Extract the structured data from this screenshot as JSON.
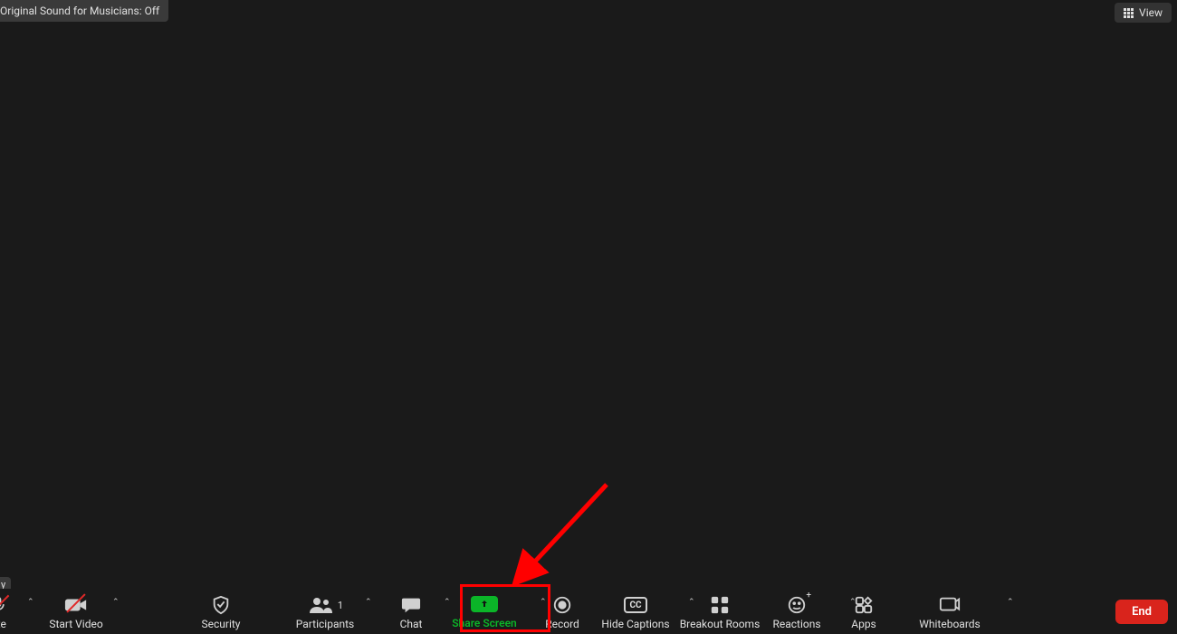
{
  "topbar": {
    "original_sound_label": "Original Sound for Musicians: Off",
    "view_label": "View"
  },
  "letter_pill": "y",
  "toolbar": {
    "mute_label": "ute",
    "start_video_label": "Start Video",
    "security_label": "Security",
    "participants_label": "Participants",
    "participants_count": "1",
    "chat_label": "Chat",
    "share_screen_label": "Share Screen",
    "record_label": "Record",
    "hide_captions_label": "Hide Captions",
    "cc_text": "CC",
    "breakout_label": "Breakout Rooms",
    "reactions_label": "Reactions",
    "apps_label": "Apps",
    "whiteboards_label": "Whiteboards",
    "end_label": "End"
  },
  "colors": {
    "share_green": "#0bb528",
    "end_red": "#d9241c",
    "highlight_red": "#ff0000",
    "slash_red": "#e02828"
  },
  "annotation": {
    "highlight_target": "share-screen-button"
  }
}
